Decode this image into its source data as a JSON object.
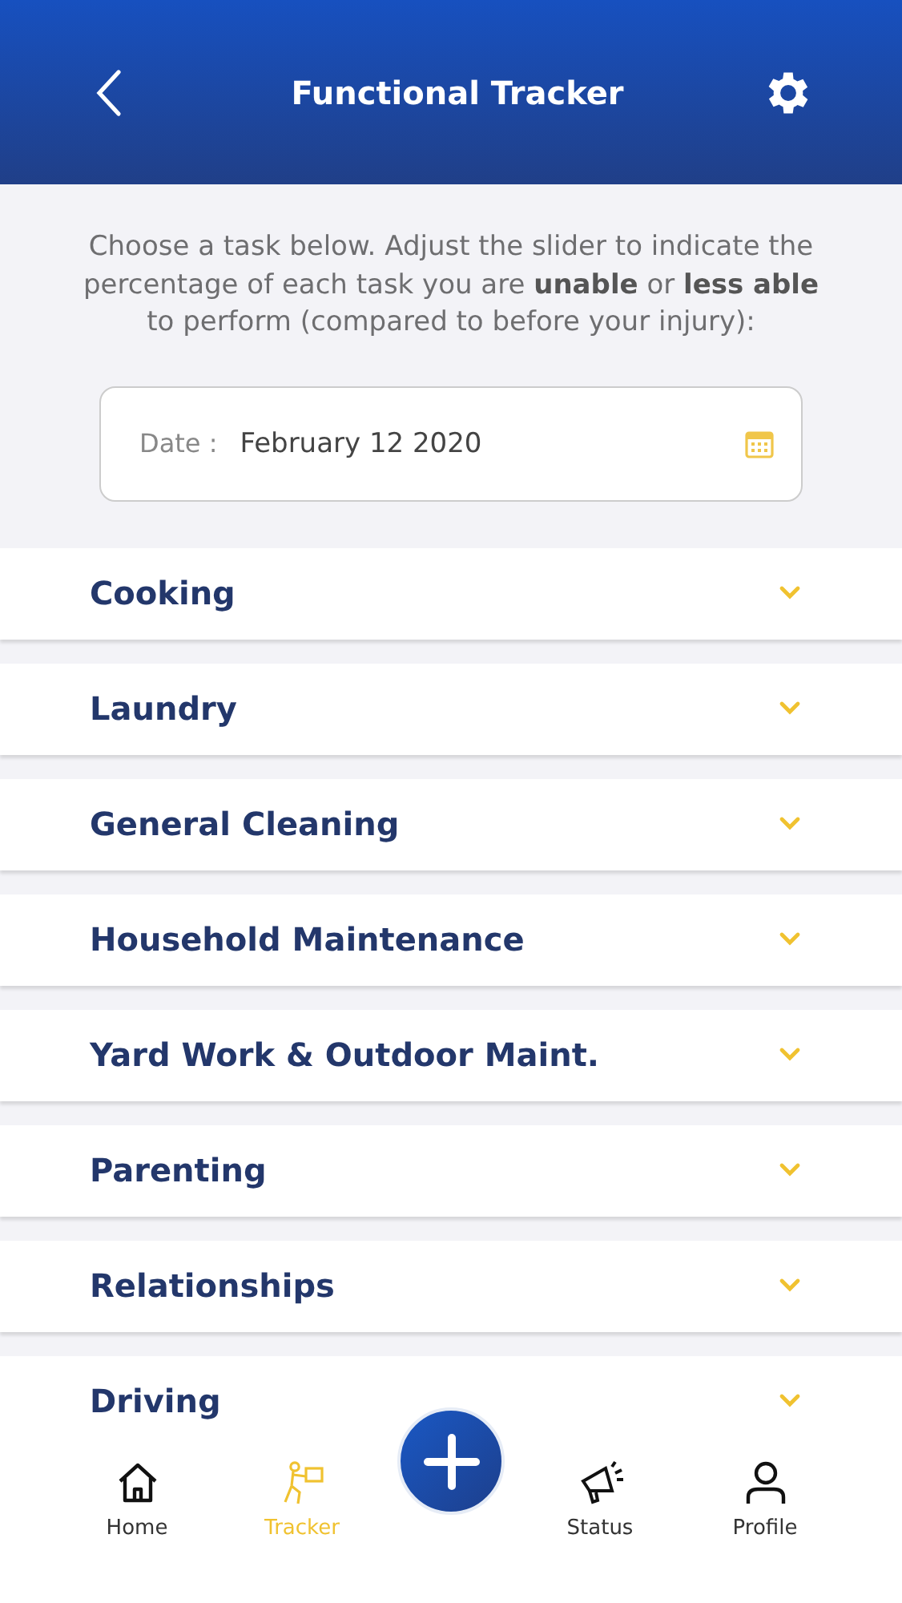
{
  "header": {
    "title": "Functional Tracker"
  },
  "intro": "Choose a task below. Adjust the slider to indicate the percentage of each task you are **unable** or **less able** to perform (compared to before your injury):",
  "date_field": {
    "label": "Date :",
    "value": "February 12 2020"
  },
  "tasks": [
    {
      "name": "Cooking",
      "expanded": false
    },
    {
      "name": "Laundry",
      "expanded": false
    },
    {
      "name": "General Cleaning",
      "expanded": false
    },
    {
      "name": "Household Maintenance",
      "expanded": false
    },
    {
      "name": "Yard Work & Outdoor Maint.",
      "expanded": false
    },
    {
      "name": "Parenting",
      "expanded": false
    },
    {
      "name": "Relationships",
      "expanded": false
    },
    {
      "name": "Driving",
      "expanded": false
    }
  ],
  "nav": [
    {
      "label": "Home",
      "kind": "home",
      "selected": false
    },
    {
      "label": "Tracker",
      "kind": "tracker",
      "selected": true
    },
    {
      "label": "Status",
      "kind": "status",
      "selected": false
    },
    {
      "label": "Profile",
      "kind": "profile",
      "selected": false
    }
  ]
}
